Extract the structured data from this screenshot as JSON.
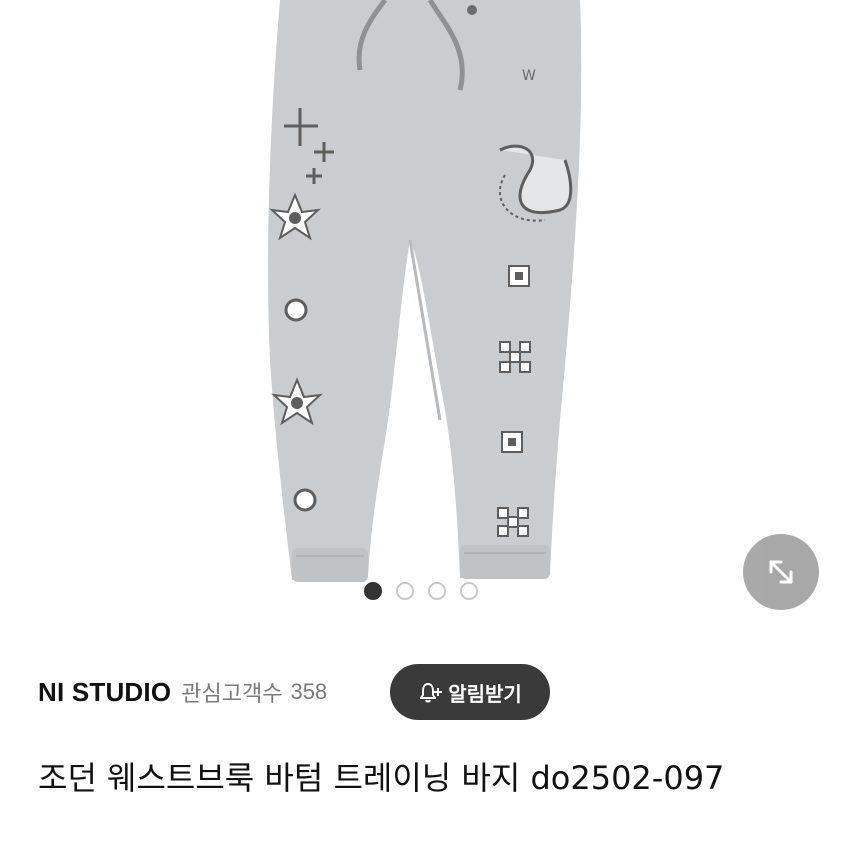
{
  "product_image": {
    "alt_icon": "sweatpants-image",
    "pagination": {
      "total": 4,
      "active": 0
    }
  },
  "expand_button": {
    "icon": "expand-arrows-icon"
  },
  "shop": {
    "name": "NI STUDIO",
    "follower_label": "관심고객수",
    "follower_count": "358"
  },
  "notify_button": {
    "label": "알림받기",
    "icon": "bell-plus-icon"
  },
  "product": {
    "title": "조던 웨스트브룩 바텀 트레이닝 바지 do2502-097"
  },
  "colors": {
    "pants": "#c9cdcf",
    "pattern": "#5e5e5e",
    "button_dark": "#3a3a3a"
  }
}
